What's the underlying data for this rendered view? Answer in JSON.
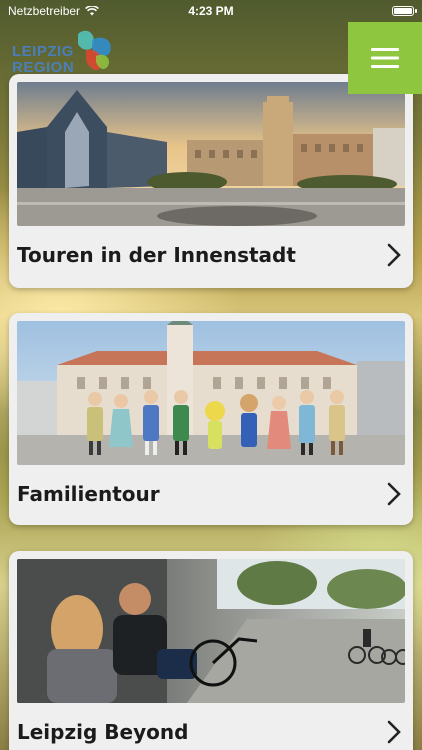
{
  "status_bar": {
    "carrier": "Netzbetreiber",
    "time": "4:23 PM"
  },
  "logo": {
    "line1": "LEIPZIG",
    "line2": "REGION",
    "colors": {
      "text": "#4b7fb8",
      "blue": "#2f8fd6",
      "red": "#e2452f",
      "green": "#8ec63f",
      "teal": "#52c2b9"
    }
  },
  "menu": {
    "icon": "hamburger-icon",
    "color": "#8ec63f"
  },
  "tours": [
    {
      "title": "Touren in der Innenstadt",
      "image": "city-center-photo",
      "chevron": "chevron-right-icon"
    },
    {
      "title": "Familientour",
      "image": "family-figures-photo",
      "chevron": "chevron-right-icon"
    },
    {
      "title": "Leipzig Beyond",
      "image": "young-people-street-photo",
      "chevron": "chevron-right-icon"
    }
  ]
}
